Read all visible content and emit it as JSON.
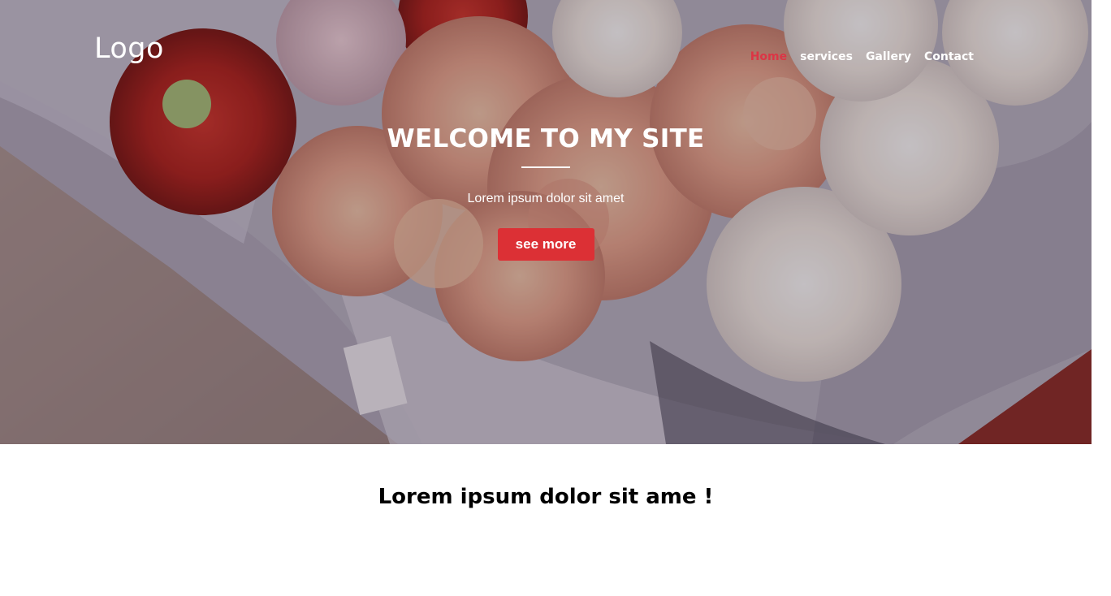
{
  "header": {
    "logo": "Logo",
    "nav": [
      {
        "label": "Home",
        "active": true
      },
      {
        "label": "services",
        "active": false
      },
      {
        "label": "Gallery",
        "active": false
      },
      {
        "label": "Contact",
        "active": false
      }
    ]
  },
  "hero": {
    "title": "WELCOME TO MY SITE",
    "subtitle": "Lorem ipsum dolor sit amet",
    "button_label": "see more",
    "background_image": "bouquet-of-roses-photo"
  },
  "section": {
    "heading": "Lorem ipsum dolor sit ame !"
  },
  "colors": {
    "accent": "#dc3545",
    "button": "#dc3035",
    "text_on_hero": "#ffffff",
    "page_background": "#ffffff"
  }
}
